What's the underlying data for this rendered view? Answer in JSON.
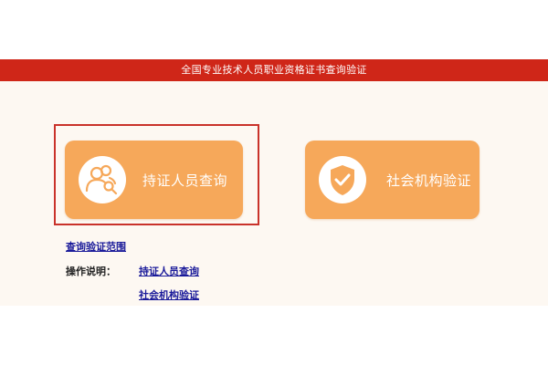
{
  "header": {
    "title": "全国专业技术人员职业资格证书查询验证"
  },
  "cards": {
    "person": {
      "label": "持证人员查询",
      "icon": "people-search-icon"
    },
    "org": {
      "label": "社会机构验证",
      "icon": "shield-check-icon"
    }
  },
  "links": {
    "scope": "查询验证范围",
    "ops_label": "操作说明：",
    "ops_person": "持证人员查询",
    "ops_org": "社会机构验证"
  },
  "colors": {
    "header_bg": "#cf2618",
    "card_bg": "#f6a85a",
    "highlight_border": "#c9322a",
    "link": "#1a1a9a",
    "content_bg": "#fdf8f2"
  }
}
